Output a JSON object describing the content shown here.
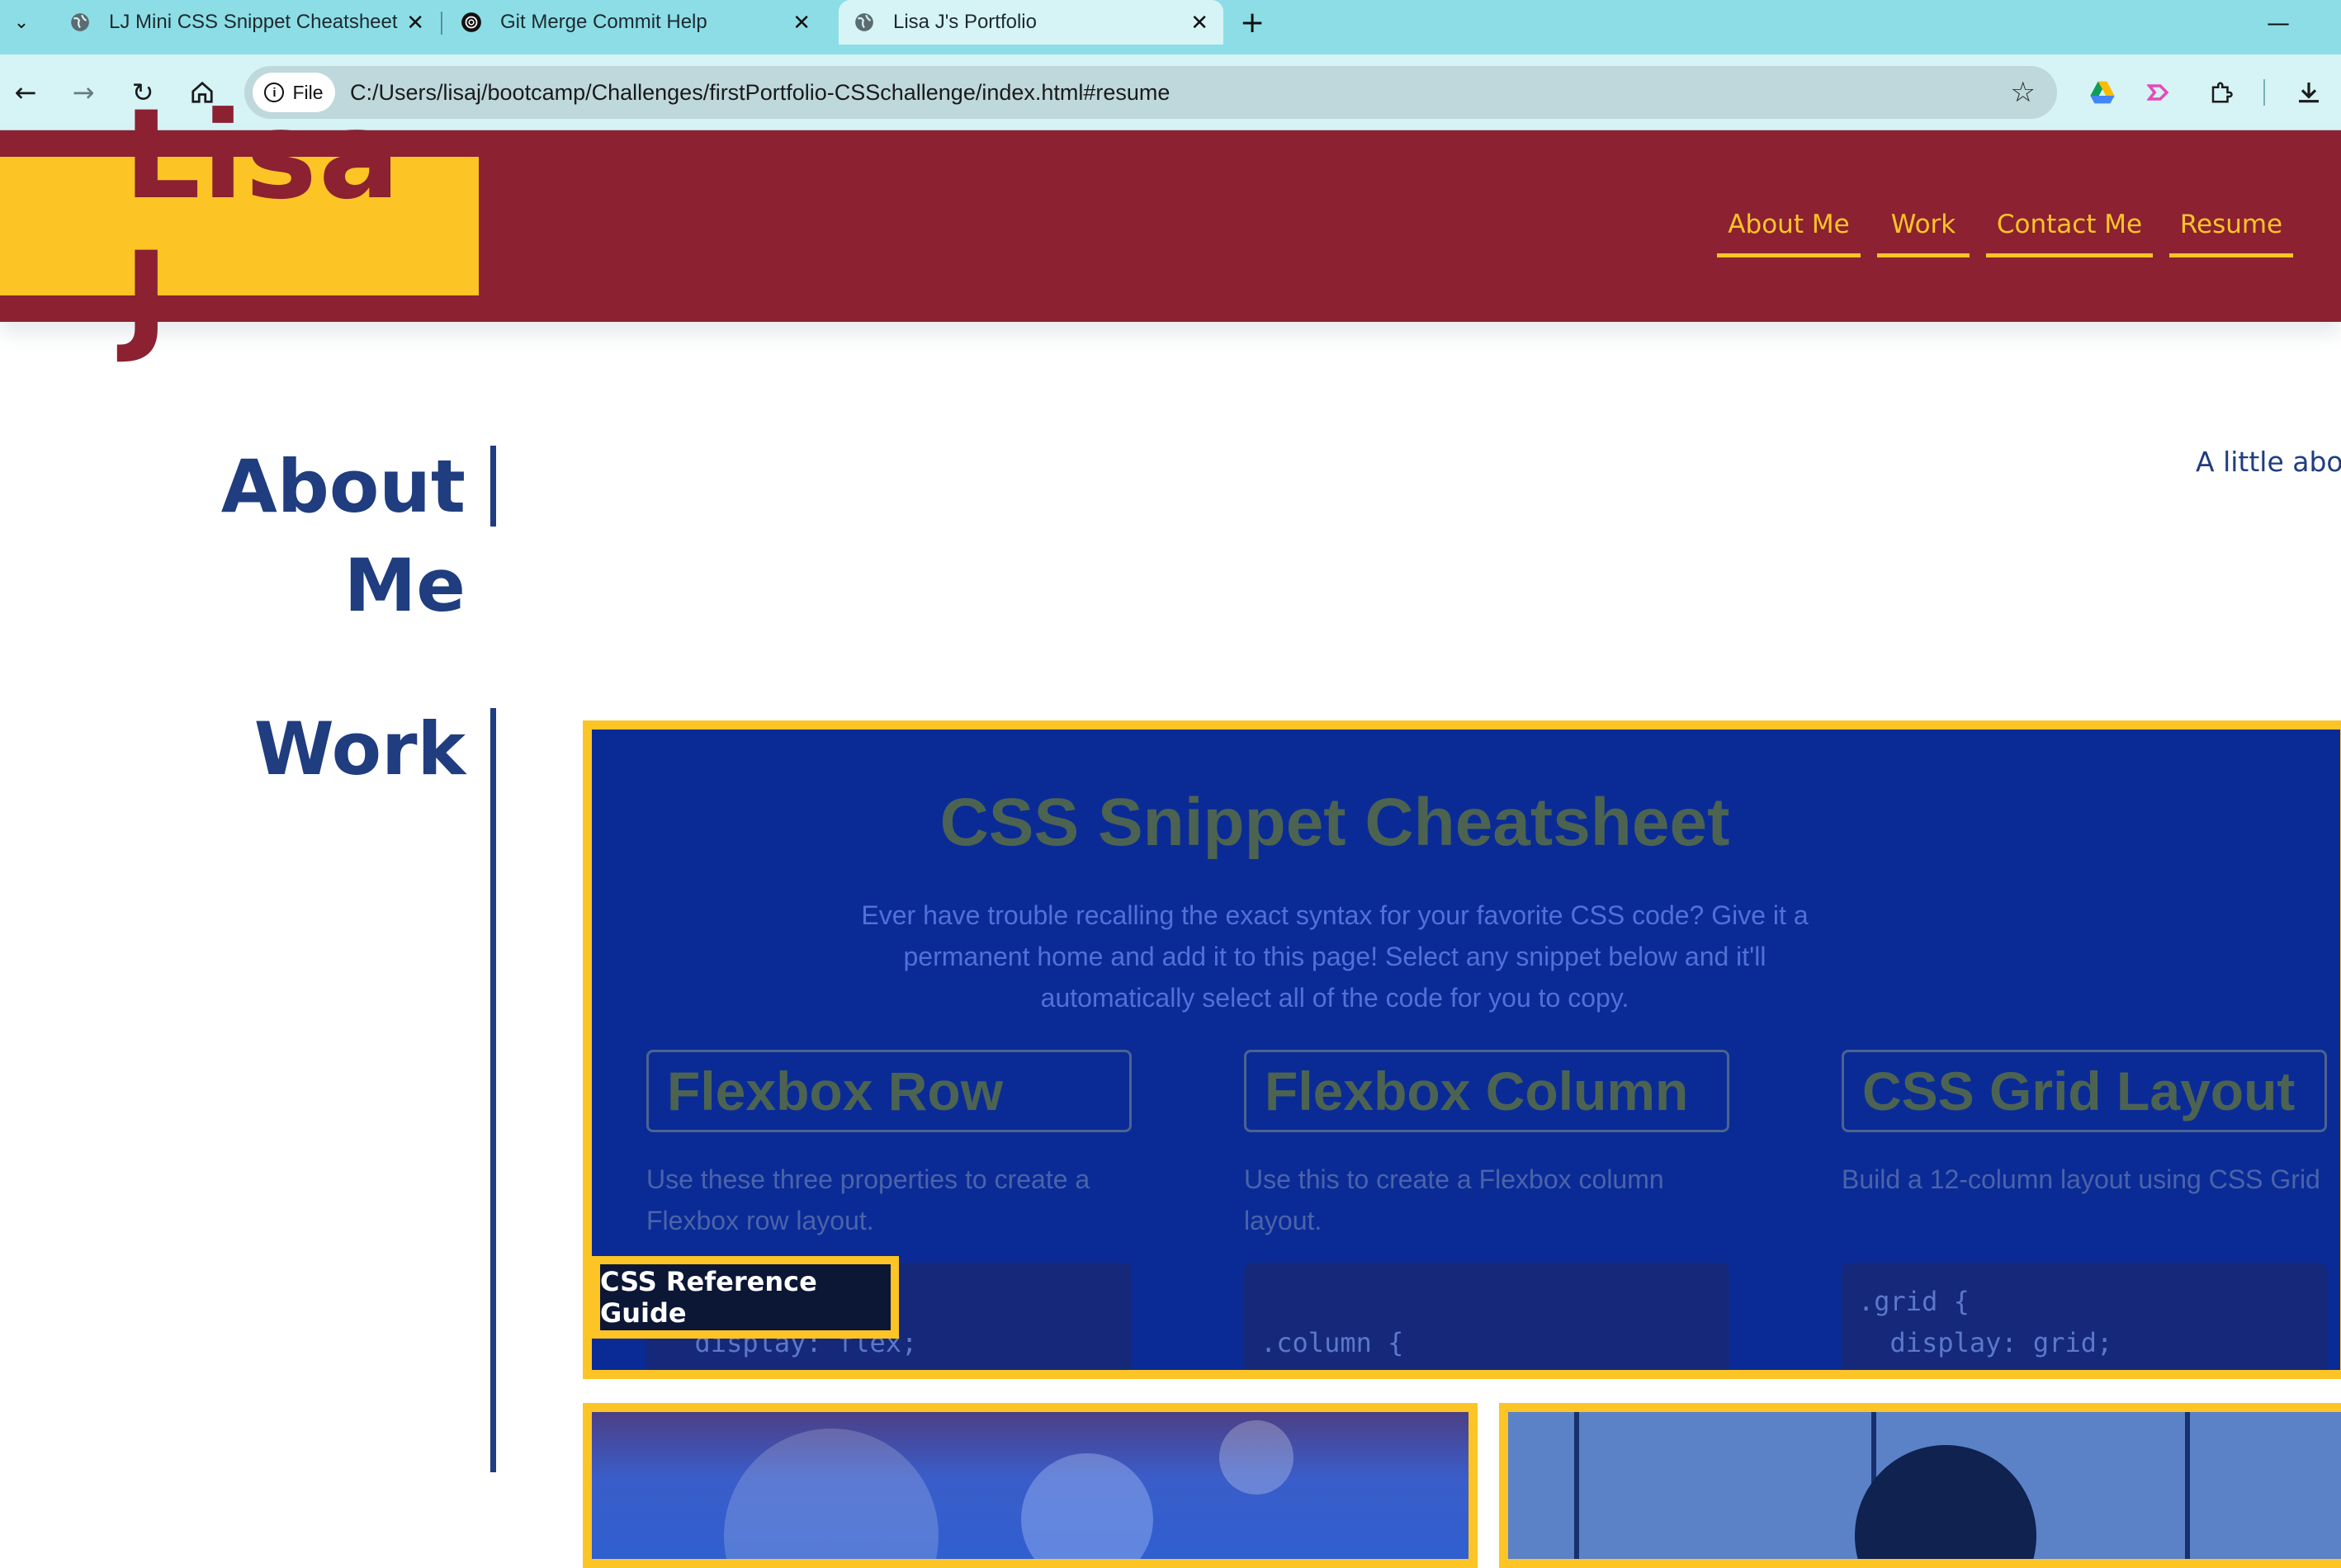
{
  "browser": {
    "tabs": [
      {
        "title": "LJ Mini CSS Snippet Cheatsheet",
        "active": false
      },
      {
        "title": "Git Merge Commit Help",
        "active": false
      },
      {
        "title": "Lisa J's Portfolio",
        "active": true
      }
    ],
    "new_tab_label": "+",
    "address": {
      "scheme_label": "File",
      "url": "C:/Users/lisaj/bootcamp/Challenges/firstPortfolio-CSSchallenge/index.html#resume"
    }
  },
  "site": {
    "logo": "Lisa J",
    "nav": [
      "About Me",
      "Work",
      "Contact Me",
      "Resume"
    ],
    "about": {
      "title": "About Me",
      "text": "A little about"
    },
    "work": {
      "title": "Work",
      "featured": {
        "label": "CSS Reference Guide",
        "preview": {
          "title": "CSS Snippet Cheatsheet",
          "description": "Ever have trouble recalling the exact syntax for your favorite CSS code? Give it a permanent home and add it to this page! Select any snippet below and it'll automatically select all of the code for you to copy.",
          "snippets": [
            {
              "title": "Flexbox Row",
              "description": "Use these three properties to create a Flexbox row layout.",
              "code": "\n  display: flex;"
            },
            {
              "title": "Flexbox Column",
              "description": "Use this to create a Flexbox column layout.",
              "code": "\n.column {"
            },
            {
              "title": "CSS Grid Layout",
              "description": "Build a 12-column layout using CSS Grid",
              "code": ".grid {\n  display: grid;"
            }
          ]
        }
      }
    }
  },
  "colors": {
    "maroon": "#8b2131",
    "gold": "#fdc426",
    "navy": "#1f3d7f",
    "tabbar": "#8ddde6",
    "toolbar": "#d6f3f6"
  }
}
